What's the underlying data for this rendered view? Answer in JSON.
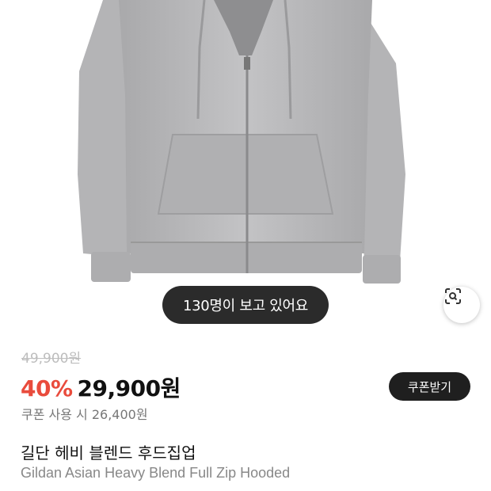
{
  "product": {
    "image_alt": "gray full zip hoodie",
    "viewers_text": "130명이 보고 있어요",
    "original_price": "49,900원",
    "discount": "40%",
    "sale_price": "29,900원",
    "coupon_price_text": "쿠폰 사용 시 26,400원",
    "coupon_button_label": "쿠폰받기",
    "title_ko": "길단 헤비 블렌드 후드집업",
    "title_en": "Gildan Asian Heavy Blend Full Zip Hooded"
  },
  "icons": {
    "lens": "lens-search-icon"
  },
  "colors": {
    "discount": "#e94b3c",
    "pill_bg": "#2b2b2b",
    "hoodie": "#b9b9bb"
  }
}
